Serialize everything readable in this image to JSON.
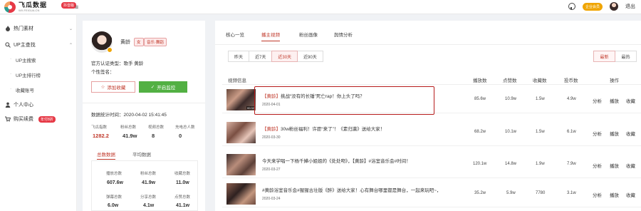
{
  "app": {
    "title": "飞瓜数据",
    "subtitle": "WX.FEIGUA.CN",
    "badge": "抖音版"
  },
  "header": {
    "vip": "企业会员",
    "logout": "退出"
  },
  "sidebar": {
    "items": [
      {
        "label": "热门素材"
      },
      {
        "label": "UP主查找"
      },
      {
        "label": "UP主搜索"
      },
      {
        "label": "UP主排行榜"
      },
      {
        "label": "收藏账号"
      },
      {
        "label": "个人中心"
      },
      {
        "label": "购买续费",
        "badge": "年付8折"
      }
    ]
  },
  "profile": {
    "name": "黄龄",
    "tags": [
      "女",
      "音乐·舞蹈"
    ],
    "certification": "官方认证类型：歌手 黄龄",
    "signature": "个性签名：",
    "fav_button": "添加收藏",
    "monitor_button": "开启监控",
    "stat_time": "数据统计时间：2020-04-02 15:41:45",
    "stats": [
      {
        "label": "飞瓜指数",
        "value": "1282.2"
      },
      {
        "label": "粉丝总数",
        "value": "41.9w"
      },
      {
        "label": "视频总数",
        "value": "8"
      },
      {
        "label": "充电总人数",
        "value": "0"
      }
    ],
    "subtabs": [
      "总数数据",
      "平均数据"
    ],
    "totals": [
      {
        "label": "播放总数",
        "value": "607.6w"
      },
      {
        "label": "粉丝总数",
        "value": "41.9w"
      },
      {
        "label": "收藏总数",
        "value": "11.0w"
      },
      {
        "label": "弹幕总数",
        "value": "6.0w"
      },
      {
        "label": "分享总数",
        "value": "4.1w"
      },
      {
        "label": "点赞总数",
        "value": "41.1w"
      }
    ]
  },
  "main": {
    "tabs": [
      "核心一览",
      "播主视频",
      "粉丝画像",
      "舆情分析"
    ],
    "ranges": [
      "昨天",
      "近7天",
      "近30天",
      "近90天"
    ],
    "sorts": [
      "最新",
      "最热"
    ],
    "columns": [
      "视频信息",
      "播放数",
      "点赞数",
      "收藏数",
      "投币数",
      "操作"
    ],
    "actions": [
      "分析",
      "播放",
      "收藏"
    ],
    "videos": [
      {
        "title_hl": "【黄龄】",
        "title": "挑战“没有的长锤”死亡rap！你上头了吗？",
        "date": "2020-04-01",
        "duration": "00:32",
        "plays": "85.6w",
        "likes": "10.9w",
        "favs": "1.5w",
        "coins": "4.9w"
      },
      {
        "title_hl": "【黄龄】",
        "title": "30w粉丝福利！许愿“来了”！《素归瀛》送给大家！",
        "date": "2020-03-30",
        "duration": "",
        "plays": "68.2w",
        "likes": "10.1w",
        "favs": "1.5w",
        "coins": "6.1w"
      },
      {
        "title_hl": "",
        "title": "今天来学唱一下杨千嬅小姐姐的《处处吻》，【黄龄】#浴室音乐会#时间！",
        "date": "2020-03-27",
        "duration": "",
        "plays": "120.1w",
        "likes": "14.8w",
        "favs": "1.9w",
        "coins": "7.9w"
      },
      {
        "title_hl": "",
        "title": "#黄龄浴室音乐会#猩猩古壮版《醉》送给大家！心有舞台哪里都是舞台，一起来玩吧~，",
        "date": "2020-03-24",
        "duration": "",
        "plays": "35.2w",
        "likes": "5.9w",
        "favs": "7780",
        "coins": "3.1w"
      }
    ]
  }
}
